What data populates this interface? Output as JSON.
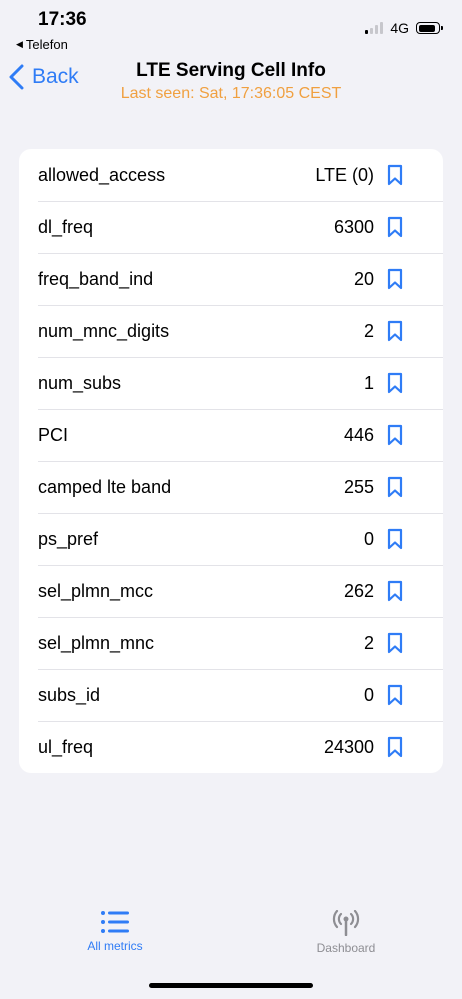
{
  "status_bar": {
    "time": "17:36",
    "back_app": "Telefon",
    "network": "4G",
    "signal_bars_filled": 1,
    "battery_level": 0.85
  },
  "nav": {
    "back_label": "Back",
    "title": "LTE Serving Cell Info",
    "subtitle": "Last seen: Sat, 17:36:05 CEST"
  },
  "metrics": [
    {
      "label": "allowed_access",
      "value": "LTE (0)"
    },
    {
      "label": "dl_freq",
      "value": "6300"
    },
    {
      "label": "freq_band_ind",
      "value": "20"
    },
    {
      "label": "num_mnc_digits",
      "value": "2"
    },
    {
      "label": "num_subs",
      "value": "1"
    },
    {
      "label": "PCI",
      "value": "446"
    },
    {
      "label": "camped lte band",
      "value": "255"
    },
    {
      "label": "ps_pref",
      "value": "0"
    },
    {
      "label": "sel_plmn_mcc",
      "value": "262"
    },
    {
      "label": "sel_plmn_mnc",
      "value": "2"
    },
    {
      "label": "subs_id",
      "value": "0"
    },
    {
      "label": "ul_freq",
      "value": "24300"
    }
  ],
  "tabs": [
    {
      "label": "All metrics",
      "icon": "list-icon",
      "active": true
    },
    {
      "label": "Dashboard",
      "icon": "antenna-icon",
      "active": false
    }
  ],
  "colors": {
    "accent": "#2f7cf6",
    "subtitle": "#f0a040",
    "background": "#f2f2f7",
    "inactive": "#8e8e93"
  }
}
